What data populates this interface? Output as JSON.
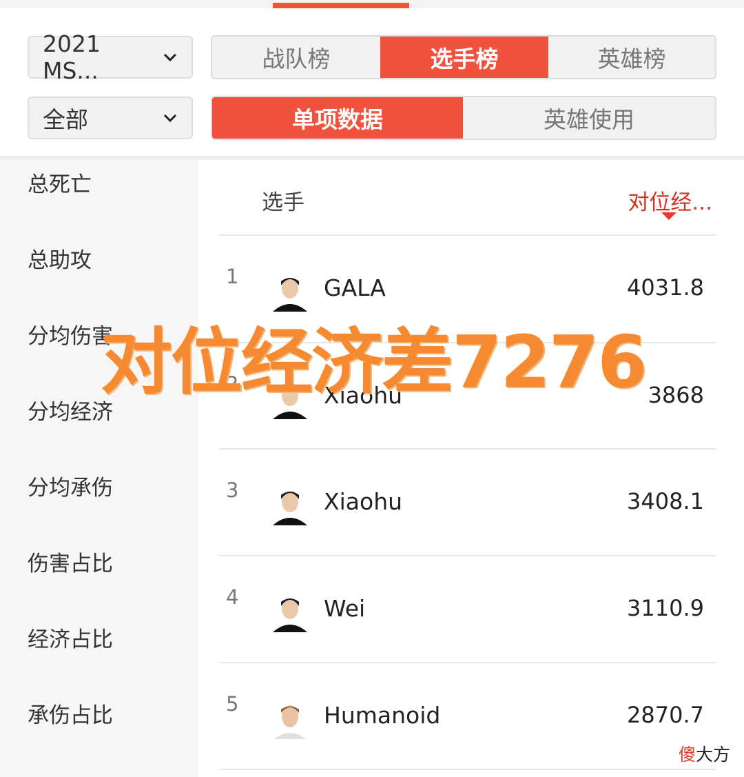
{
  "filters": {
    "season": "2021 MS...",
    "scope": "全部"
  },
  "tabs_main": [
    {
      "label": "战队榜",
      "active": false
    },
    {
      "label": "选手榜",
      "active": true
    },
    {
      "label": "英雄榜",
      "active": false
    }
  ],
  "tabs_sub": [
    {
      "label": "单项数据",
      "active": true
    },
    {
      "label": "英雄使用",
      "active": false
    }
  ],
  "sidebar": {
    "items": [
      "总死亡",
      "总助攻",
      "分均伤害",
      "分均经济",
      "分均承伤",
      "伤害占比",
      "经济占比",
      "承伤占比"
    ]
  },
  "table": {
    "col_player": "选手",
    "col_metric": "对位经...",
    "rows": [
      {
        "rank": "1",
        "player": "GALA",
        "value": "4031.8"
      },
      {
        "rank": "2",
        "player": "Xiaohu",
        "value": "3868"
      },
      {
        "rank": "3",
        "player": "Xiaohu",
        "value": "3408.1"
      },
      {
        "rank": "4",
        "player": "Wei",
        "value": "3110.9"
      },
      {
        "rank": "5",
        "player": "Humanoid",
        "value": "2870.7"
      }
    ]
  },
  "overlay_text": "对位经济差7276",
  "watermark": {
    "highlight": "傻",
    "rest": "大方"
  },
  "colors": {
    "accent": "#f0523e",
    "overlay": "#f58a32",
    "metric_header": "#d2321f"
  }
}
